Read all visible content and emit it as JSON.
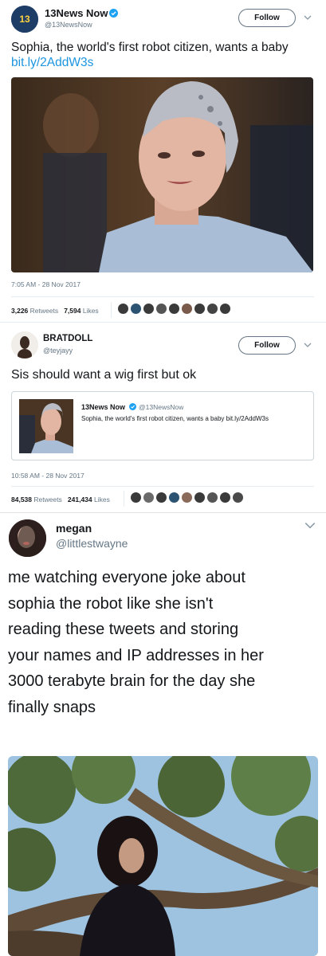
{
  "tweet1": {
    "name": "13News Now",
    "handle": "@13NewsNow",
    "follow_label": "Follow",
    "text": "Sophia, the world's first robot citizen, wants a baby ",
    "link": "bit.ly/2AddW3s",
    "timestamp": "7:05 AM - 28 Nov 2017",
    "retweets": "3,226",
    "retweets_label": "Retweets",
    "likes": "7,594",
    "likes_label": "Likes",
    "colors": {
      "verified": "#1da1f2",
      "link": "#1b95e0"
    }
  },
  "tweet2": {
    "name": "BRATDOLL",
    "handle": "@teyjayy",
    "follow_label": "Follow",
    "text": "Sis should want a wig first but ok",
    "quote": {
      "name": "13News Now",
      "handle": "@13NewsNow",
      "text": "Sophia, the world's first robot citizen, wants a baby bit.ly/2AddW3s"
    },
    "timestamp": "10:58 AM - 28 Nov 2017",
    "retweets": "84,538",
    "retweets_label": "Retweets",
    "likes": "241,434",
    "likes_label": "Likes"
  },
  "post": {
    "name": "megan",
    "handle": "@littlestwayne",
    "text_lines": [
      "me watching everyone joke about",
      "sophia the robot like she isn't",
      "reading these tweets and storing",
      "your names and IP addresses in her",
      "3000 terabyte brain for the day she",
      "finally snaps"
    ]
  }
}
